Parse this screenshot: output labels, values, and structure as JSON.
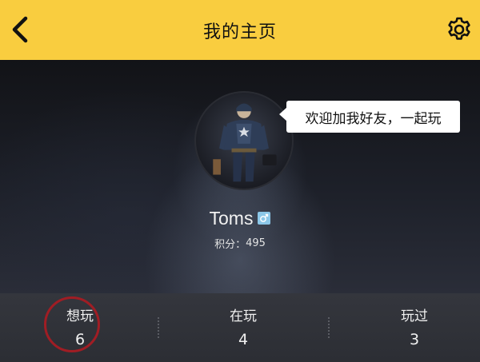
{
  "header": {
    "title": "我的主页",
    "back_icon": "chevron-left-icon",
    "settings_icon": "gear-icon",
    "background_color": "#f9cd3f"
  },
  "profile": {
    "bubble_text": "欢迎加我好友，一起玩",
    "username": "Toms",
    "gender_icon": "male-icon",
    "points_label": "积分：",
    "points_value": "495"
  },
  "stats": [
    {
      "label": "想玩",
      "count": "6",
      "active": true
    },
    {
      "label": "在玩",
      "count": "4",
      "active": false
    },
    {
      "label": "玩过",
      "count": "3",
      "active": false
    }
  ],
  "colors": {
    "accent_ring": "#a01d24",
    "badge": "#8cc7e8"
  }
}
